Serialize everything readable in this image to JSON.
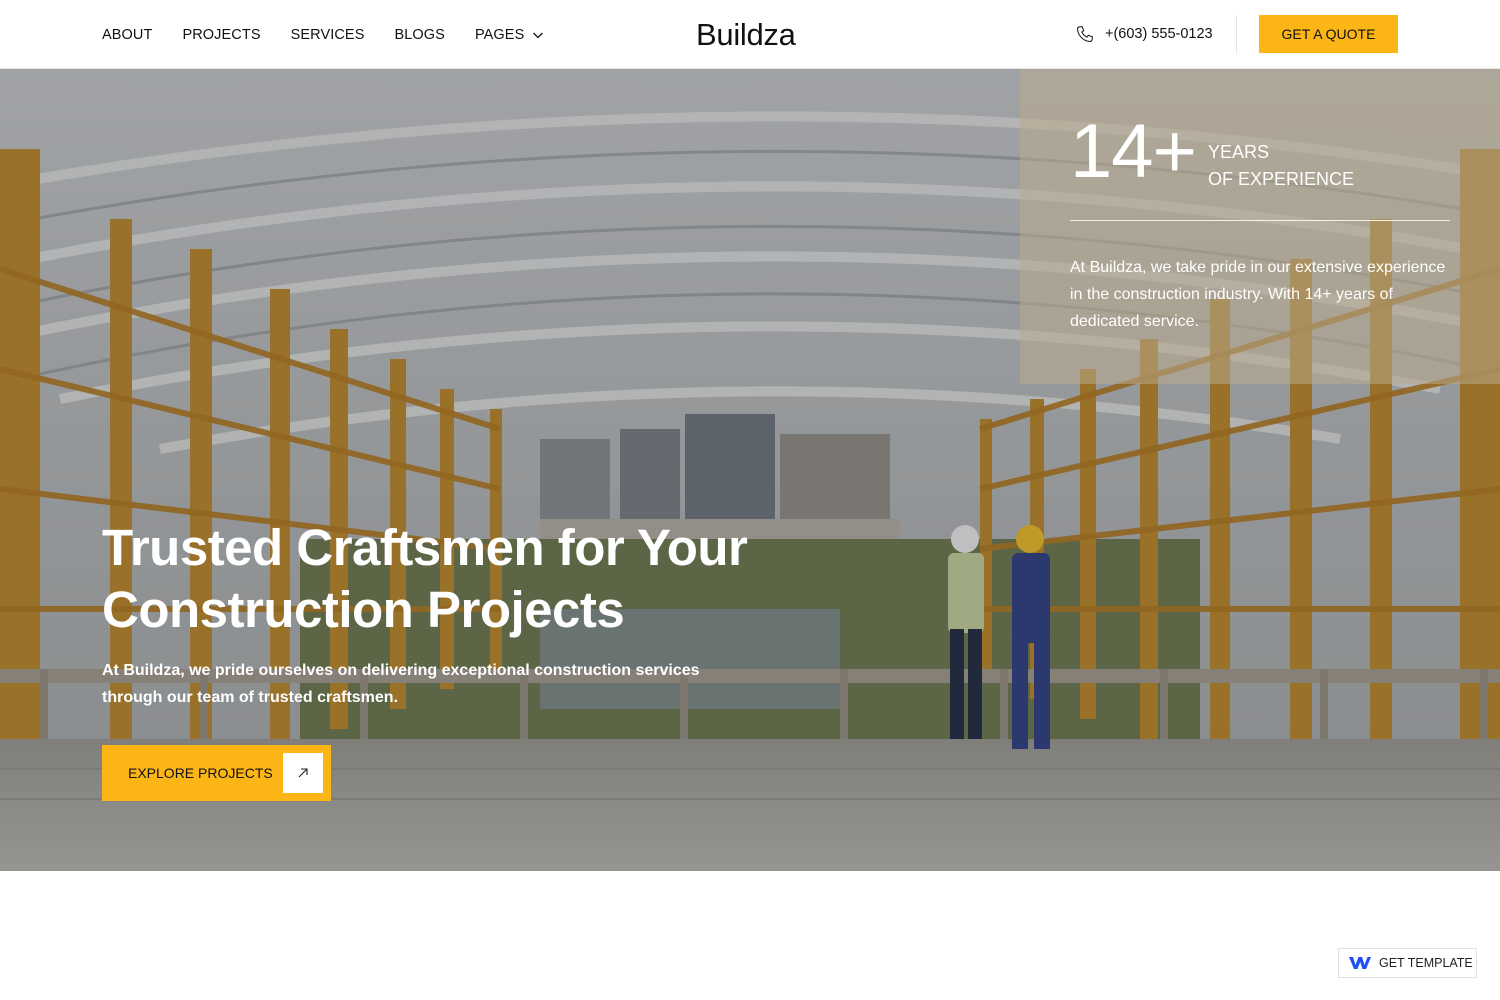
{
  "header": {
    "nav": [
      {
        "label": "ABOUT"
      },
      {
        "label": "PROJECTS"
      },
      {
        "label": "SERVICES"
      },
      {
        "label": "BLOGS"
      },
      {
        "label": "PAGES",
        "icon": "chevron-down-icon"
      }
    ],
    "logo": "Buildza",
    "phone": "+(603) 555-0123",
    "phone_icon": "phone-icon",
    "quote_label": "GET A QUOTE"
  },
  "hero": {
    "stat": {
      "number": "14+",
      "label_line1": "YEARS",
      "label_line2": "OF EXPERIENCE",
      "description": "At Buildza, we take pride in our extensive experience in the construction industry. With 14+ years of dedicated service."
    },
    "title": "Trusted Craftsmen for Your Construction Projects",
    "subtitle": "At Buildza, we pride ourselves on delivering exceptional construction services through our team of trusted craftsmen.",
    "cta_label": "EXPLORE PROJECTS",
    "cta_icon": "arrow-up-right-icon"
  },
  "badge": {
    "label": "GET TEMPLATE",
    "icon": "webflow-logo-icon"
  },
  "colors": {
    "accent": "#fbb615",
    "text": "#111111",
    "white": "#ffffff"
  }
}
